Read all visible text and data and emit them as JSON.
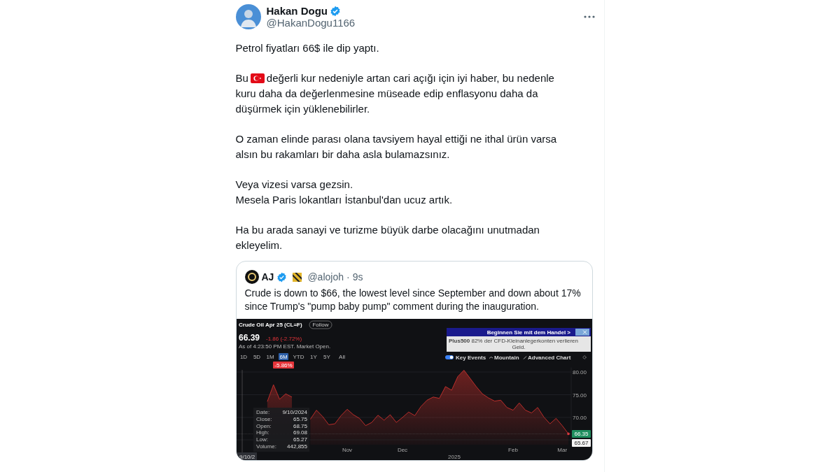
{
  "tweet": {
    "author": {
      "name": "Hakan Dogu",
      "verified": true,
      "handle": "@HakanDogu1166"
    },
    "paragraphs": [
      {
        "kind": "text",
        "text": "Petrol fiyatları 66$ ile dip yaptı."
      },
      {
        "kind": "with-icon",
        "before": "Bu",
        "lines": [
          "değerli kur nedeniyle artan cari açığı için iyi haber, bu nedenle",
          "kuru daha da değerlenmesine müseade edip enflasyonu daha da",
          "düşürmek için yüklenebilirler."
        ]
      },
      {
        "kind": "text",
        "text": "O zaman elinde parası olana tavsiyem hayal ettiği ne ithal ürün varsa alsın bu rakamları bir daha asla bulamazsınız."
      },
      {
        "kind": "text",
        "text": "Veya vizesi varsa gezsin.\nMesela Paris lokantları İstanbul'dan ucuz artık."
      },
      {
        "kind": "text",
        "text": "Ha bu arada sanayi ve turizme büyük darbe olacağını unutmadan ekleyelim."
      }
    ],
    "quote": {
      "author": {
        "name": "AJ",
        "verified": true,
        "handle": "@alojoh",
        "separator": "·",
        "time": "9s"
      },
      "text": "Crude is down to $66, the lowest level since September and down about 17% since Trump's \"pump baby pump\" comment during the inauguration.",
      "image": {
        "title": "Crude Oil Apr 25 (CL=F)",
        "follow_button": "Follow",
        "price": "66.39",
        "change": "-1.86",
        "change_percent": "(-2.72%)",
        "as_of": "As of 4:23:50 PM EST. Market Open.",
        "ranges": [
          {
            "label": "1D",
            "selected": false
          },
          {
            "label": "5D",
            "selected": false
          },
          {
            "label": "1M",
            "selected": false
          },
          {
            "label": "6M",
            "selected": true
          },
          {
            "label": "YTD",
            "selected": false
          },
          {
            "label": "1Y",
            "selected": false
          },
          {
            "label": "5Y",
            "selected": false
          },
          {
            "label": "All",
            "selected": false
          }
        ],
        "range_change": "-5.86%",
        "ad": {
          "headline": "Beginnen Sie mit dem Handel >",
          "brand": "Plus500",
          "disclaimer_lines": [
            "82% der CFD-Kleinanlegerkonten verlieren",
            "Geld."
          ]
        },
        "key_events": {
          "label": "Key Events",
          "on": true
        },
        "chart_type": "Mountain",
        "advanced_chart": "Advanced Chart",
        "price_tags": [
          {
            "kind": "last",
            "text": "66.35"
          },
          {
            "kind": "low",
            "text": "65.67"
          }
        ],
        "tooltip": [
          {
            "label": "Date:",
            "value": "9/10/2024"
          },
          {
            "label": "Close:",
            "value": "65.75"
          },
          {
            "label": "Open:",
            "value": "68.75"
          },
          {
            "label": "High:",
            "value": "69.08"
          },
          {
            "label": "Low:",
            "value": "65.27"
          },
          {
            "label": "Volume:",
            "value": "442,855"
          }
        ],
        "cursor_date": "9/10/2",
        "year_label": "2025",
        "chart_data": {
          "type": "area",
          "grid": true,
          "categories": [
            null,
            null,
            null,
            null,
            null,
            null,
            null,
            null,
            null,
            null,
            null,
            null,
            null,
            null,
            null,
            null,
            null,
            null,
            "Nov",
            null,
            null,
            null,
            null,
            null,
            null,
            null,
            null,
            "Dec",
            null,
            null,
            null,
            null,
            null,
            null,
            null,
            null,
            null,
            null,
            null,
            null,
            null,
            null,
            null,
            null,
            null,
            "Feb",
            null,
            null,
            null,
            null,
            null,
            null,
            null,
            "Mar",
            null
          ],
          "series": [
            {
              "color": "#c9302c",
              "values": [
                null,
                null,
                null,
                null,
                null,
                73.5,
                77.2,
                74,
                75.2,
                74.5,
                null,
                null,
                69.6,
                71.6,
                70.2,
                68.4,
                68.6,
                70.4,
                71.8,
                70.6,
                69.8,
                68.2,
                68.9,
                70.5,
                69.4,
                70.6,
                68.9,
                70,
                71.2,
                70.4,
                72.4,
                73.8,
                74.5,
                74.2,
                76.8,
                76,
                79,
                80.4,
                78.6,
                76.8,
                75.2,
                74.3,
                73.6,
                73.8,
                72.2,
                71.6,
                73.2,
                71.6,
                71,
                72.2,
                70.1,
                68.6,
                69.8,
                68.2,
                66.4
              ]
            }
          ],
          "ylim": [
            64,
            81
          ],
          "yticks": [
            {
              "value": 70,
              "label": "70.00"
            },
            {
              "value": 75,
              "label": "75.00"
            },
            {
              "value": 80,
              "label": "80.00"
            }
          ]
        }
      }
    }
  }
}
